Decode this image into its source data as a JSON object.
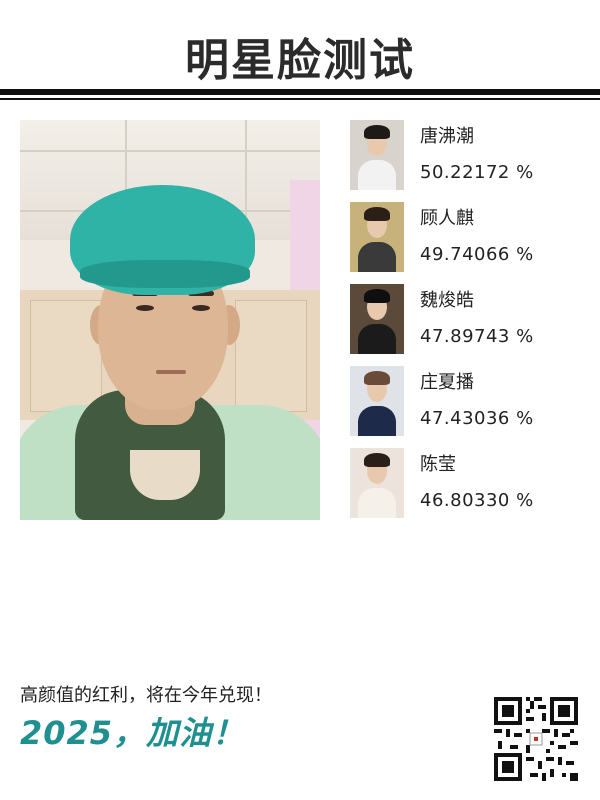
{
  "header": {
    "title": "明星脸测试"
  },
  "photo": {
    "alt": "user-selfie"
  },
  "results": [
    {
      "name": "唐沸潮",
      "score": "50.22172 %"
    },
    {
      "name": "顾人麒",
      "score": "49.74066 %"
    },
    {
      "name": "魏焌皓",
      "score": "47.89743 %"
    },
    {
      "name": "庄夏播",
      "score": "47.43036 %"
    },
    {
      "name": "陈莹",
      "score": "46.80330 %"
    }
  ],
  "footer": {
    "slogan": "高颜值的红利，将在今年兑现！",
    "cheer": "2025，加油！"
  },
  "colors": {
    "cheer": "#1f8f8f",
    "rule": "#111111",
    "cap": "#2fb3a6"
  }
}
